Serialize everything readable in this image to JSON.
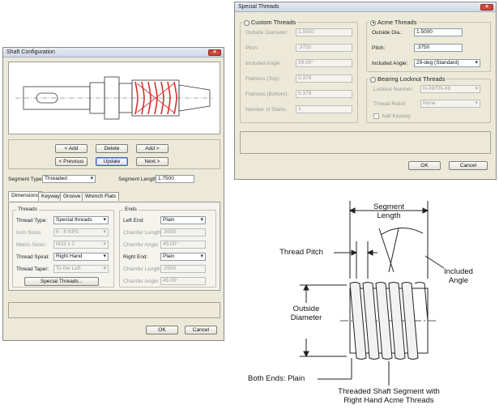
{
  "shaft_dialog": {
    "title": "Shaft Configuration",
    "buttons": {
      "add_left": "< Add",
      "delete": "Delete",
      "add_right": "Add >",
      "previous": "< Previous",
      "update": "Update",
      "next": "Next >",
      "special_threads": "Special Threads...",
      "ok": "OK",
      "cancel": "Cancel"
    },
    "segment_type": {
      "label": "Segment Type:",
      "value": "Threaded"
    },
    "segment_length": {
      "label": "Segment Length:",
      "value": "1.7500"
    },
    "tabs": [
      "Dimensions",
      "Keyway",
      "Groove",
      "Wrench Flats"
    ],
    "threads_group": {
      "title": "Threads",
      "rows": [
        {
          "label": "Thread Type:",
          "value": "Special threads",
          "enabled": true
        },
        {
          "label": "Inch Sizes:",
          "value": "6 - 8 NPS",
          "enabled": false
        },
        {
          "label": "Metric Sizes:",
          "value": "M33 x 2",
          "enabled": false
        },
        {
          "label": "Thread Spiral:",
          "value": "Right Hand",
          "enabled": true
        },
        {
          "label": "Thread Taper:",
          "value": "To the Left",
          "enabled": false
        }
      ]
    },
    "ends_group": {
      "title": "Ends",
      "rows": [
        {
          "label": "Left End:",
          "value": "Plain",
          "enabled": true
        },
        {
          "label": "Chamfer Length:",
          "value": ".0000",
          "enabled": false
        },
        {
          "label": "Chamfer Angle:",
          "value": "45.00°",
          "enabled": false
        },
        {
          "label": "Right End:",
          "value": "Plain",
          "enabled": true
        },
        {
          "label": "Chamfer Length:",
          "value": ".0500",
          "enabled": false
        },
        {
          "label": "Chamfer Angle:",
          "value": "45.00°",
          "enabled": false
        }
      ]
    },
    "colors": {
      "highlight_thread": "#d9312a"
    }
  },
  "special_dialog": {
    "title": "Special Threads",
    "custom_group": {
      "title": "Custom Threads",
      "selected": false,
      "rows": [
        {
          "label": "Outside Diameter:",
          "value": "1.5000"
        },
        {
          "label": "Pitch:",
          "value": ".3750"
        },
        {
          "label": "Included Angle:",
          "value": "29.00°"
        },
        {
          "label": "Flatness (Top):",
          "value": "0.379"
        },
        {
          "label": "Flatness (Bottom):",
          "value": "0.379"
        },
        {
          "label": "Number of Starts:",
          "value": "1"
        }
      ]
    },
    "acme_group": {
      "title": "Acme Threads",
      "selected": true,
      "rows": [
        {
          "label": "Outside Dia.:",
          "value": "1.5000"
        },
        {
          "label": "Pitch:",
          "value": ".3750"
        },
        {
          "label": "Included Angle:",
          "value": "29-deg (Standard)"
        }
      ]
    },
    "locknut_group": {
      "title": "Bearing Locknut Threads",
      "selected": false,
      "rows": [
        {
          "label": "Locknut Number:",
          "value": "N-08/TN-08"
        },
        {
          "label": "Thread Relief:",
          "value": "None"
        }
      ],
      "add_keyway": "Add Keyway"
    },
    "buttons": {
      "ok": "OK",
      "cancel": "Cancel"
    }
  },
  "diagram": {
    "segment_length": "Segment\nLength",
    "thread_pitch": "Thread Pitch",
    "included_angle": "Included\nAngle",
    "outside_diameter": "Outside\nDiameter",
    "both_ends": "Both Ends: Plain",
    "caption": "Threaded Shaft Segment with\nRight Hand Acme Threads"
  }
}
